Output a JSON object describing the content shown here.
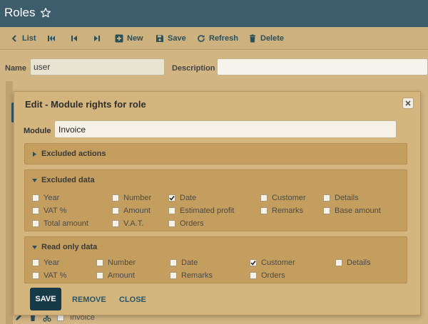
{
  "header": {
    "title": "Roles"
  },
  "toolbar": {
    "list": "List",
    "new": "New",
    "save": "Save",
    "refresh": "Refresh",
    "delete": "Delete"
  },
  "form": {
    "name_label": "Name",
    "name_value": "user",
    "description_label": "Description",
    "description_value": ""
  },
  "background_row": {
    "label": "Invoice"
  },
  "dialog": {
    "title": "Edit - Module rights for role",
    "module_label": "Module",
    "module_value": "Invoice",
    "excluded_actions": {
      "title": "Excluded actions",
      "expanded": false
    },
    "excluded_data": {
      "title": "Excluded data",
      "expanded": true,
      "items": [
        {
          "label": "Year",
          "checked": false
        },
        {
          "label": "Number",
          "checked": false
        },
        {
          "label": "Date",
          "checked": true
        },
        {
          "label": "Customer",
          "checked": false
        },
        {
          "label": "Details",
          "checked": false
        },
        {
          "label": "VAT %",
          "checked": false
        },
        {
          "label": "Amount",
          "checked": false
        },
        {
          "label": "Estimated profit",
          "checked": false
        },
        {
          "label": "Remarks",
          "checked": false
        },
        {
          "label": "Base amount",
          "checked": false
        },
        {
          "label": "Total amount",
          "checked": false
        },
        {
          "label": "V.A.T.",
          "checked": false
        },
        {
          "label": "Orders",
          "checked": false
        }
      ]
    },
    "read_only_data": {
      "title": "Read only data",
      "expanded": true,
      "items": [
        {
          "label": "Year",
          "checked": false
        },
        {
          "label": "Number",
          "checked": false
        },
        {
          "label": "Date",
          "checked": false
        },
        {
          "label": "Customer",
          "checked": true
        },
        {
          "label": "Details",
          "checked": false
        },
        {
          "label": "VAT %",
          "checked": false
        },
        {
          "label": "Amount",
          "checked": false
        },
        {
          "label": "Remarks",
          "checked": false
        },
        {
          "label": "Orders",
          "checked": false
        }
      ]
    },
    "buttons": {
      "save": "SAVE",
      "remove": "REMOVE",
      "close": "CLOSE"
    }
  },
  "colors": {
    "header_bg": "#3d5d6c",
    "page_bg": "#c9ad78",
    "panel_bg": "#c49e5e",
    "accent": "#173a48",
    "link": "#2a5665"
  }
}
